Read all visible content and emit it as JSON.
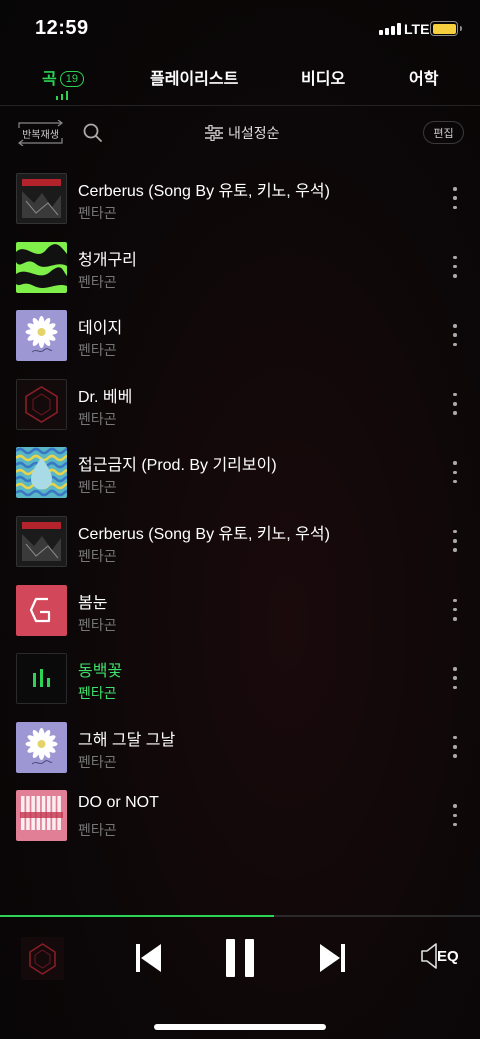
{
  "status": {
    "time": "12:59",
    "network": "LTE",
    "battery_color": "#f6cf3f"
  },
  "tabs": [
    {
      "label": "곡",
      "count": "19",
      "active": true
    },
    {
      "label": "플레이리스트"
    },
    {
      "label": "비디오"
    },
    {
      "label": "어학"
    }
  ],
  "toolbar": {
    "repeat_label": "반복재생",
    "sort_label": "내설정순",
    "edit_label": "편집",
    "icons": [
      "repeat-icon",
      "search-icon",
      "sliders-icon"
    ]
  },
  "songs": [
    {
      "title": "Cerberus (Song By 유토, 키노, 우석)",
      "artist": "펜타곤",
      "art": "cerberus"
    },
    {
      "title": "청개구리",
      "artist": "펜타곤",
      "art": "green"
    },
    {
      "title": "데이지",
      "artist": "펜타곤",
      "art": "daisy"
    },
    {
      "title": "Dr. 베베",
      "artist": "펜타곤",
      "art": "pentagon-dark"
    },
    {
      "title": "접근금지 (Prod. By 기리보이)",
      "artist": "펜타곤",
      "art": "wave"
    },
    {
      "title": "Cerberus (Song By 유토, 키노, 우석)",
      "artist": "펜타곤",
      "art": "cerberus"
    },
    {
      "title": "봄눈",
      "artist": "펜타곤",
      "art": "pink-logo"
    },
    {
      "title": "동백꽃",
      "artist": "펜타곤",
      "art": "playing-eq",
      "playing": true
    },
    {
      "title": "그해 그달 그날",
      "artist": "펜타곤",
      "art": "daisy"
    },
    {
      "title": "DO or NOT",
      "artist": "펜타곤",
      "art": "do-or-not"
    }
  ],
  "player": {
    "progress": 0.57,
    "accent": "#2dd354",
    "eq_label": "EQ",
    "icons": [
      "previous-icon",
      "pause-icon",
      "next-icon",
      "speaker-eq-icon"
    ]
  }
}
